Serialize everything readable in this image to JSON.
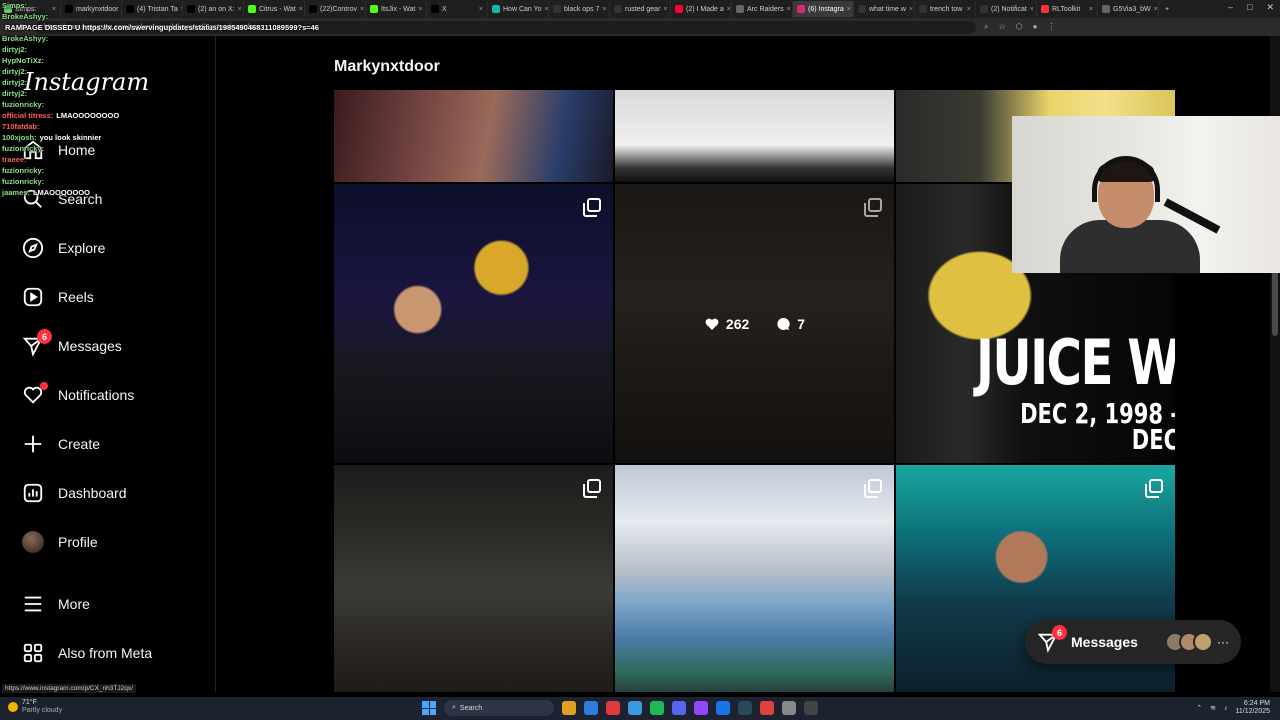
{
  "browser": {
    "tabs": [
      {
        "label": "Simps:",
        "color": "#6ad06a"
      },
      {
        "label": "markynxtdoor",
        "color": "#000"
      },
      {
        "label": "(4) Tristan Ta",
        "color": "#000"
      },
      {
        "label": "(2) an on X:",
        "color": "#000"
      },
      {
        "label": "Citrus - Wat",
        "color": "#53fc18"
      },
      {
        "label": "(22)Controv",
        "color": "#000"
      },
      {
        "label": "ItsJix - Wat",
        "color": "#53fc18"
      },
      {
        "label": "X",
        "color": "#000"
      },
      {
        "label": "How Can Yo",
        "color": "#1ab5a5"
      },
      {
        "label": "black ops 7",
        "color": "#333"
      },
      {
        "label": "rusted gear",
        "color": "#333"
      },
      {
        "label": "(2) I Made a",
        "color": "#ff0033"
      },
      {
        "label": "Arc Raiders",
        "color": "#666"
      },
      {
        "label": "(6) Instagra",
        "color": "#d62976",
        "active": true
      },
      {
        "label": "what time w",
        "color": "#333"
      },
      {
        "label": "trench tow",
        "color": "#333"
      },
      {
        "label": "(2) Notificat",
        "color": "#333"
      },
      {
        "label": "RLToolkit",
        "color": "#ff3333"
      },
      {
        "label": "G5Via3_bW",
        "color": "#666"
      }
    ],
    "new_tab": "+",
    "url": "https://www.instagram.com/explore/search/keyword/?q=markynxtdoor",
    "status_link": "https://www.instagram.com/p/CX_nh3TJ2qx/"
  },
  "chat": [
    {
      "user": "Simps:",
      "text": "",
      "color": "green"
    },
    {
      "user": "BrokeAshyy:",
      "text": "",
      "color": "green"
    },
    {
      "user": "",
      "text": "RAMPAGE DISSED U https://x.com/swervingupdates/status/1985490468311089599?s=46",
      "color": "green"
    },
    {
      "user": "BrokeAshyy:",
      "text": "",
      "color": "green"
    },
    {
      "user": "dirtyj2:",
      "text": "",
      "color": "green"
    },
    {
      "user": "HypNoTiXz:",
      "text": "",
      "color": "green"
    },
    {
      "user": "dirtyj2:",
      "text": "",
      "color": "green"
    },
    {
      "user": "dirtyj2:",
      "text": "",
      "color": "green"
    },
    {
      "user": "dirtyj2:",
      "text": "",
      "color": "green"
    },
    {
      "user": "fuzionricky:",
      "text": "",
      "color": "green"
    },
    {
      "user": "official titress:",
      "text": "LMAOOOOOOOO",
      "color": "red"
    },
    {
      "user": "710fatdab:",
      "text": "",
      "color": "red"
    },
    {
      "user": "100xjosh:",
      "text": "you look skinnier",
      "color": "green"
    },
    {
      "user": "fuzionricky:",
      "text": "",
      "color": "green"
    },
    {
      "user": "traeee:",
      "text": "",
      "color": "red"
    },
    {
      "user": "fuzionricky:",
      "text": "",
      "color": "green"
    },
    {
      "user": "fuzionricky:",
      "text": "",
      "color": "green"
    },
    {
      "user": "jaames:",
      "text": "LMAOOOOOOO",
      "color": "green"
    }
  ],
  "sidebar": {
    "logo": "Instagram",
    "items": [
      {
        "label": "Home",
        "icon": "home-icon"
      },
      {
        "label": "Search",
        "icon": "search-icon"
      },
      {
        "label": "Explore",
        "icon": "compass-icon"
      },
      {
        "label": "Reels",
        "icon": "reels-icon"
      },
      {
        "label": "Messages",
        "icon": "messenger-icon",
        "badge": "6"
      },
      {
        "label": "Notifications",
        "icon": "heart-icon",
        "dot": true
      },
      {
        "label": "Create",
        "icon": "plus-icon"
      },
      {
        "label": "Dashboard",
        "icon": "dashboard-icon"
      },
      {
        "label": "Profile",
        "icon": "avatar"
      },
      {
        "label": "More",
        "icon": "menu-icon"
      },
      {
        "label": "Also from Meta",
        "icon": "meta-grid-icon"
      }
    ]
  },
  "main": {
    "search_title": "Markynxtdoor",
    "hovered_post": {
      "likes": "262",
      "comments": "7"
    },
    "juice_tile": {
      "line1": "JUICE W",
      "line2": "DEC 2, 1998 - DEC"
    }
  },
  "messages_pill": {
    "label": "Messages",
    "badge": "6",
    "more": "···"
  },
  "taskbar": {
    "weather_temp": "71°F",
    "weather_desc": "Partly cloudy",
    "search": "Search",
    "time": "6:24 PM",
    "date": "11/12/2025"
  },
  "colors": {
    "accent_badge": "#ff3040",
    "background": "#000000",
    "text": "#f5f5f5"
  }
}
